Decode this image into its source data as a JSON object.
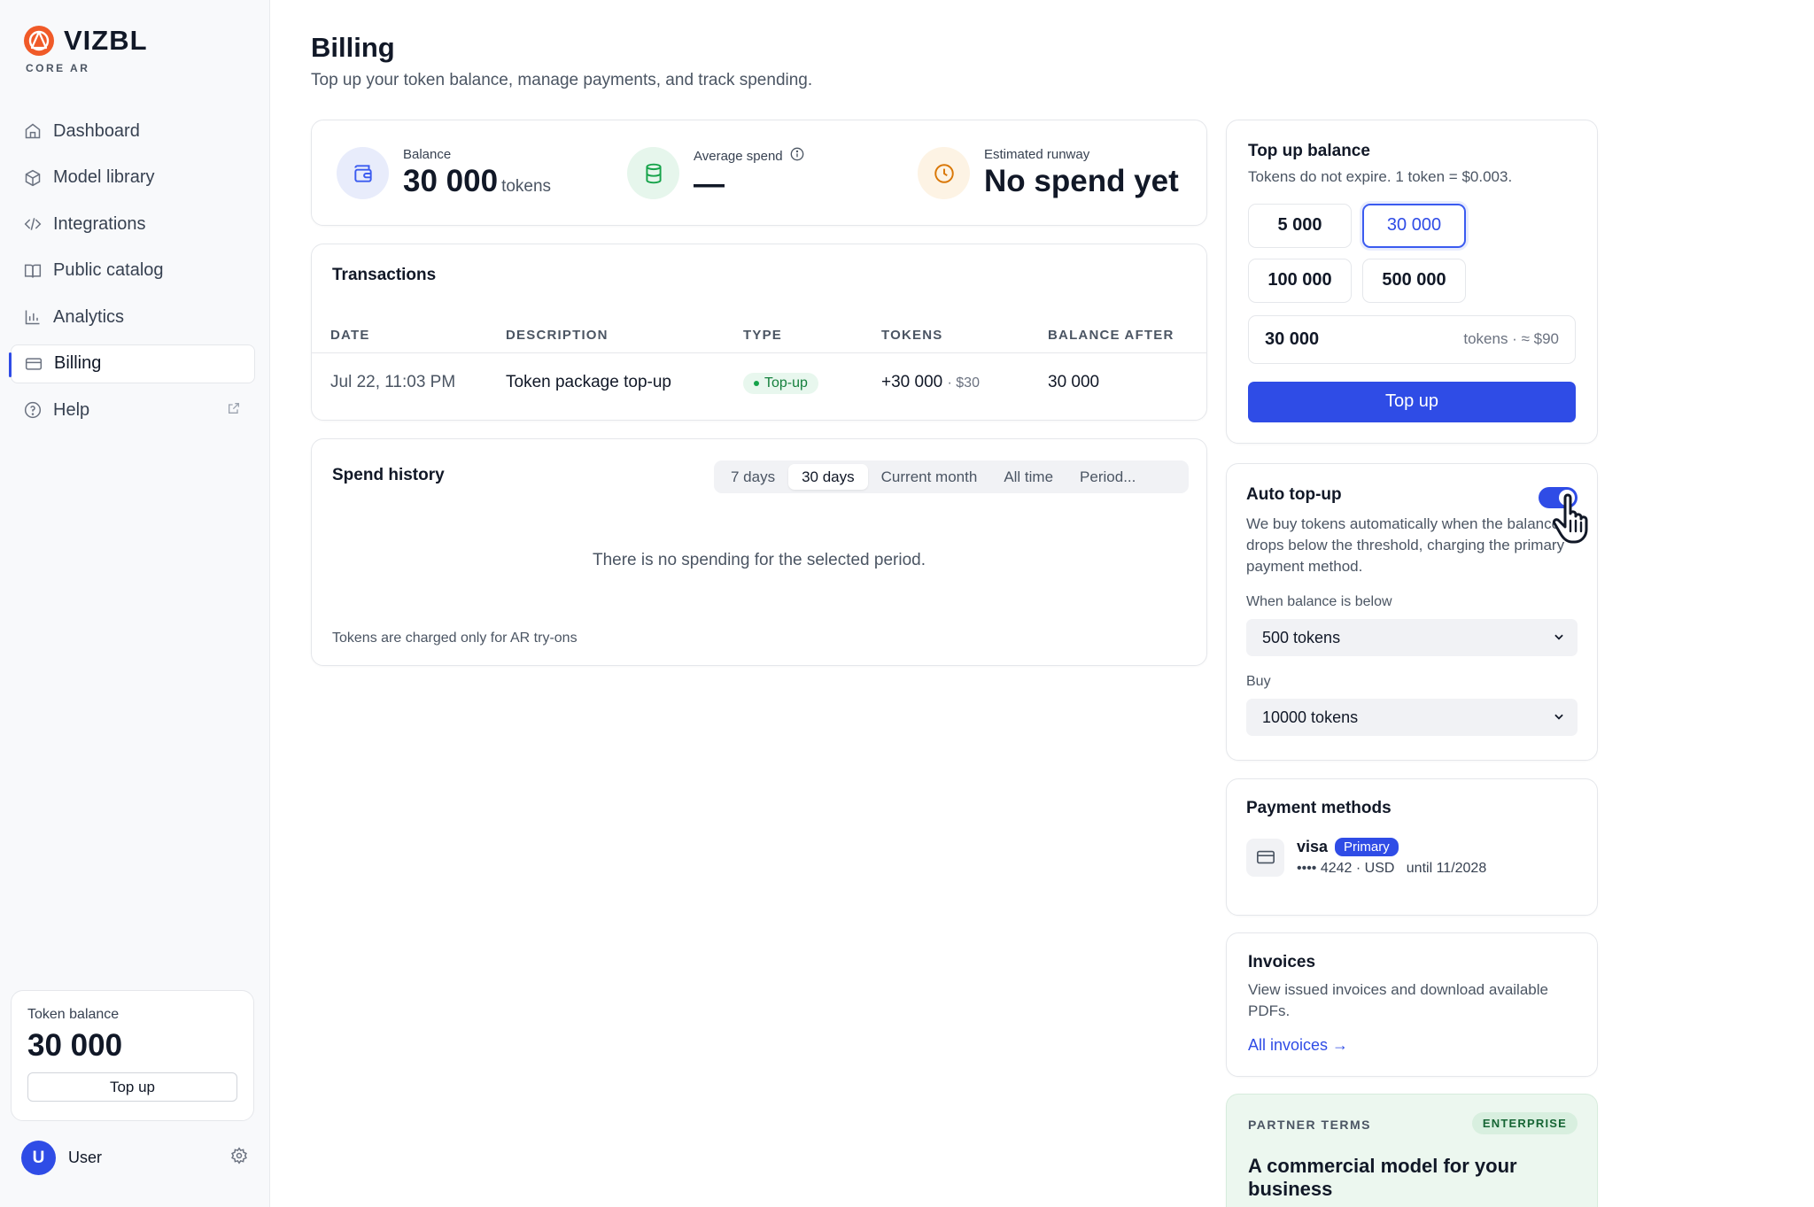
{
  "brand": {
    "name": "VIZBL",
    "sub": "CORE AR",
    "accent": "#f05a28"
  },
  "colors": {
    "primary": "#2f4ce6",
    "success": "#16a34a"
  },
  "sidebar": {
    "items": [
      {
        "label": "Dashboard",
        "icon": "home-icon"
      },
      {
        "label": "Model library",
        "icon": "cube-icon"
      },
      {
        "label": "Integrations",
        "icon": "code-icon"
      },
      {
        "label": "Public catalog",
        "icon": "book-icon"
      },
      {
        "label": "Analytics",
        "icon": "bar-chart-icon"
      },
      {
        "label": "Billing",
        "icon": "credit-card-icon",
        "active": true
      },
      {
        "label": "Help",
        "icon": "help-circle-icon"
      }
    ],
    "token_card": {
      "label": "Token balance",
      "value": "30 000",
      "button": "Top up"
    },
    "user": {
      "initial": "U",
      "name": "User"
    }
  },
  "header": {
    "title": "Billing",
    "subtitle": "Top up your token balance, manage payments, and track spending."
  },
  "stats": {
    "balance": {
      "label": "Balance",
      "value": "30 000",
      "unit": "tokens"
    },
    "average": {
      "label": "Average spend",
      "value": "—"
    },
    "runway": {
      "label": "Estimated runway",
      "value": "No spend yet"
    }
  },
  "transactions": {
    "title": "Transactions",
    "columns": [
      "DATE",
      "DESCRIPTION",
      "TYPE",
      "TOKENS",
      "BALANCE AFTER"
    ],
    "rows": [
      {
        "date": "Jul 22, 11:03 PM",
        "description": "Token package top-up",
        "type": "Top-up",
        "tokens": "+30 000",
        "amount": "· $30",
        "balance_after": "30 000"
      }
    ]
  },
  "spend_history": {
    "title": "Spend history",
    "periods": [
      "7 days",
      "30 days",
      "Current month",
      "All time",
      "Period..."
    ],
    "selected_period": "30 days",
    "empty": "There is no spending for the selected period.",
    "note": "Tokens are charged only for AR try-ons"
  },
  "topup": {
    "title": "Top up balance",
    "subtitle": "Tokens do not expire. 1 token = $0.003.",
    "packages": [
      "5 000",
      "30 000",
      "100 000",
      "500 000"
    ],
    "selected_package": "30 000",
    "amount_value": "30 000",
    "amount_hint": "tokens · ≈ $90",
    "button": "Top up"
  },
  "auto_topup": {
    "title": "Auto top-up",
    "enabled": true,
    "description": "We buy tokens automatically when the balance drops below the threshold, charging the primary payment method.",
    "threshold_label": "When balance is below",
    "threshold_value": "500 tokens",
    "buy_label": "Buy",
    "buy_value": "10000 tokens"
  },
  "payment": {
    "title": "Payment methods",
    "brand": "visa",
    "badge": "Primary",
    "detail": "•••• 4242 · USD   until 11/2028"
  },
  "invoices": {
    "title": "Invoices",
    "description": "View issued invoices and download available PDFs.",
    "link": "All invoices →"
  },
  "partner": {
    "kicker": "PARTNER TERMS",
    "badge": "ENTERPRISE",
    "title": "A commercial model for your business"
  }
}
